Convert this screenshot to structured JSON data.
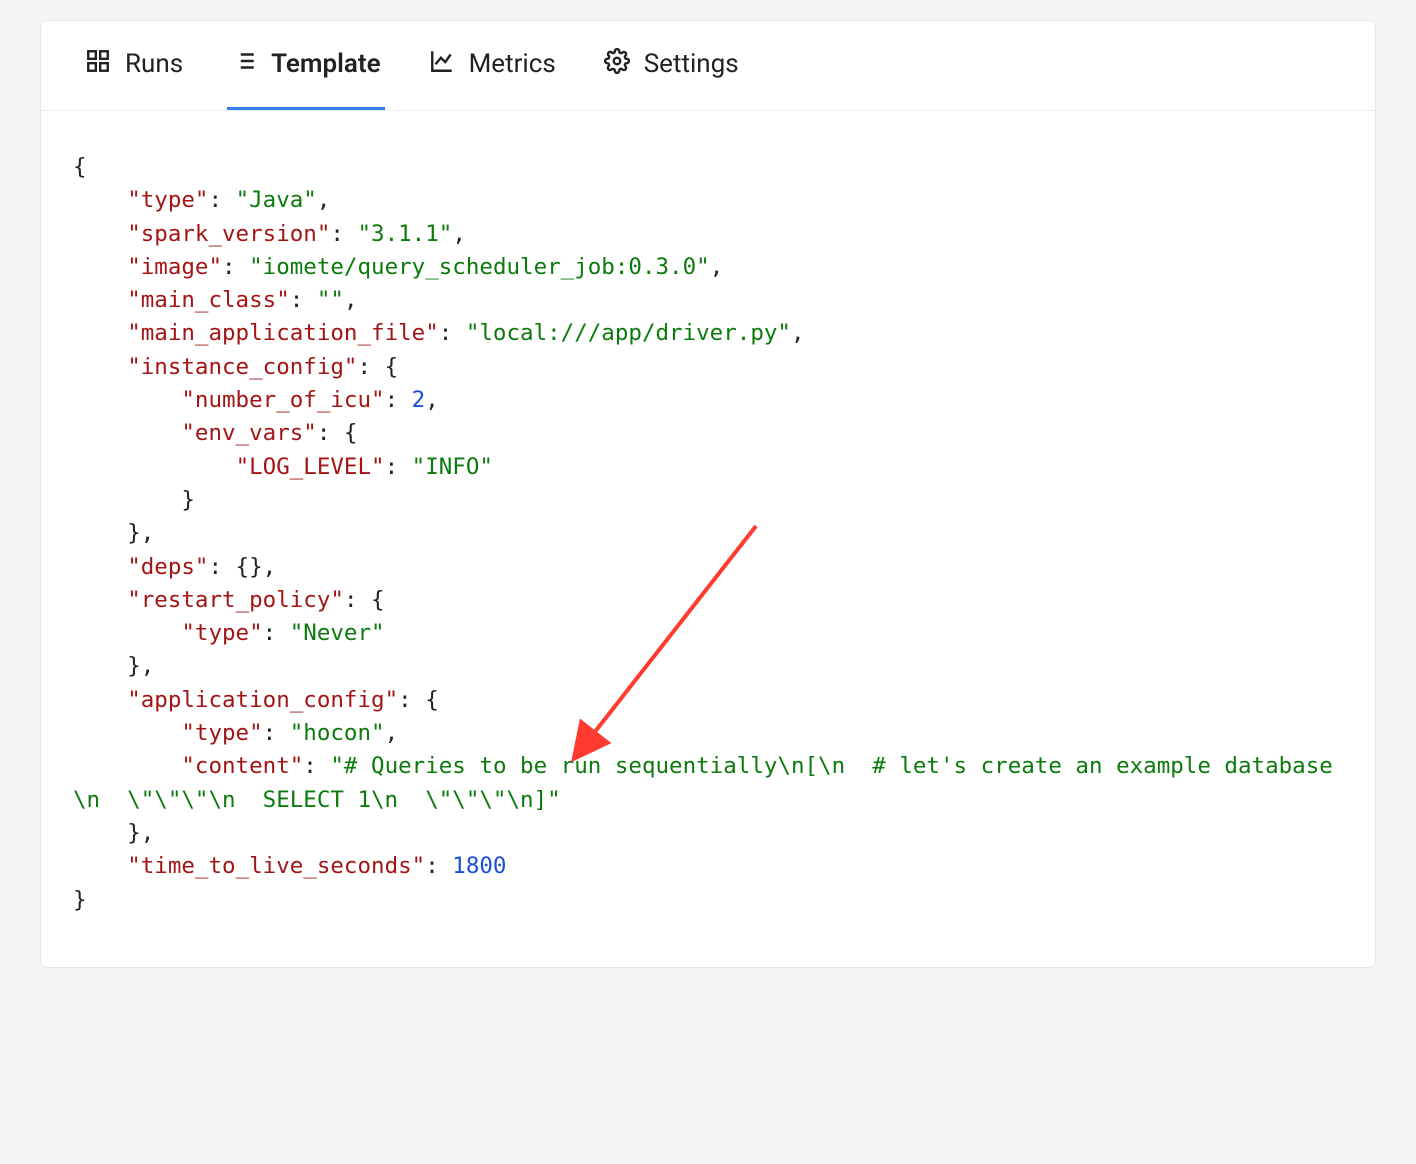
{
  "tabs": [
    {
      "id": "runs",
      "label": "Runs",
      "icon": "grid"
    },
    {
      "id": "template",
      "label": "Template",
      "icon": "list",
      "active": true
    },
    {
      "id": "metrics",
      "label": "Metrics",
      "icon": "chart"
    },
    {
      "id": "settings",
      "label": "Settings",
      "icon": "gear"
    }
  ],
  "code": {
    "type_key": "\"type\"",
    "type_val": "\"Java\"",
    "spark_version_key": "\"spark_version\"",
    "spark_version_val": "\"3.1.1\"",
    "image_key": "\"image\"",
    "image_val": "\"iomete/query_scheduler_job:0.3.0\"",
    "main_class_key": "\"main_class\"",
    "main_class_val": "\"\"",
    "main_app_file_key": "\"main_application_file\"",
    "main_app_file_val": "\"local:///app/driver.py\"",
    "instance_config_key": "\"instance_config\"",
    "number_of_icu_key": "\"number_of_icu\"",
    "number_of_icu_val": "2",
    "env_vars_key": "\"env_vars\"",
    "log_level_key": "\"LOG_LEVEL\"",
    "log_level_val": "\"INFO\"",
    "deps_key": "\"deps\"",
    "restart_policy_key": "\"restart_policy\"",
    "restart_type_key": "\"type\"",
    "restart_type_val": "\"Never\"",
    "app_config_key": "\"application_config\"",
    "app_config_type_key": "\"type\"",
    "app_config_type_val": "\"hocon\"",
    "content_key": "\"content\"",
    "content_val": "\"# Queries to be run sequentially\\n[\\n  # let's create an example database\\n  \\\"\\\"\\\"\\n  SELECT 1\\n  \\\"\\\"\\\"\\n]\"",
    "ttl_key": "\"time_to_live_seconds\"",
    "ttl_val": "1800"
  },
  "arrow": {
    "color": "#ff3b30"
  }
}
